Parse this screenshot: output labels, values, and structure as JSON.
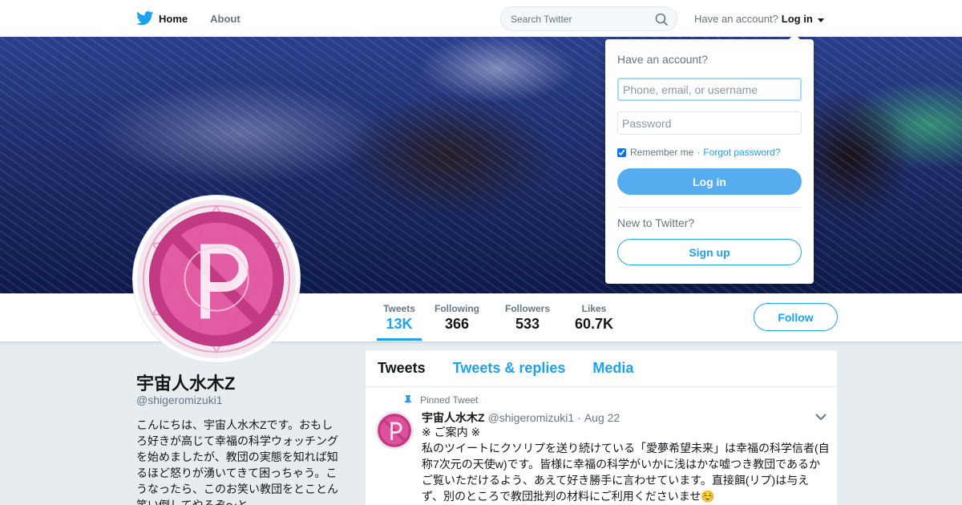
{
  "nav": {
    "home_label": "Home",
    "about_label": "About",
    "search_placeholder": "Search Twitter",
    "account_prompt": "Have an account?",
    "login_label": "Log in"
  },
  "profile": {
    "name": "宇宙人水木Z",
    "handle": "@shigeromizuki1",
    "bio": "こんにちは、宇宙人水木Zです。おもしろ好きが高じて幸福の科学ウォッチングを始めましたが、教団の実態を知れば知るほど怒りが湧いてきて困っちゃう。こうなったら、このお笑い教団をとことん笑い倒してやるぞ〜と"
  },
  "stats": [
    {
      "label": "Tweets",
      "value": "13K"
    },
    {
      "label": "Following",
      "value": "366"
    },
    {
      "label": "Followers",
      "value": "533"
    },
    {
      "label": "Likes",
      "value": "60.7K"
    }
  ],
  "follow_label": "Follow",
  "timeline": {
    "tabs": [
      "Tweets",
      "Tweets & replies",
      "Media"
    ],
    "pinned_label": "Pinned Tweet",
    "tweet": {
      "name": "宇宙人水木Z",
      "handle": "@shigeromizuki1",
      "dot": "·",
      "date": "Aug 22",
      "line1": "※ ご案内 ※",
      "text": "私のツイートにクソリプを送り続けている「愛夢希望未来」は幸福の科学信者(自称7次元の天使w)です。皆様に幸福の科学がいかに浅はかな嘘つき教団であるかご覧いただけるよう、あえて好き勝手に言わせています。直接餌(リプ)は与えず、別のところで教団批判の材料にご利用くださいませ☺️"
    }
  },
  "login_dropdown": {
    "title": "Have an account?",
    "username_placeholder": "Phone, email, or username",
    "password_placeholder": "Password",
    "remember_label": "Remember me",
    "separator": "·",
    "forgot_label": "Forgot password?",
    "login_button": "Log in",
    "new_prompt": "New to Twitter?",
    "signup_button": "Sign up"
  },
  "colors": {
    "accent": "#1da1f2",
    "login_button": "#55acee",
    "avatar_pink": "#e0509c"
  }
}
